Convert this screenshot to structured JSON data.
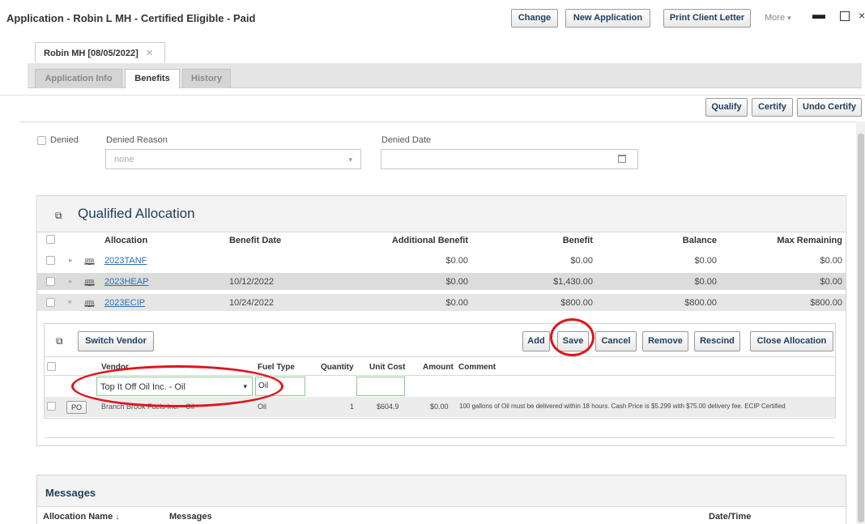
{
  "window": {
    "title": "Application - Robin L MH - Certified Eligible - Paid",
    "buttons": {
      "change": "Change",
      "new_application": "New Application",
      "print_letter": "Print Client Letter",
      "more": "More"
    }
  },
  "doc_tab": {
    "label": "Robin MH [08/05/2022]"
  },
  "tabs": [
    "Application Info",
    "Benefits",
    "History"
  ],
  "toolbar": {
    "qualify": "Qualify",
    "certify": "Certify",
    "undo_certify": "Undo Certify"
  },
  "denied": {
    "checkbox_label": "Denied",
    "reason_label": "Denied Reason",
    "reason_value": "none",
    "date_label": "Denied Date",
    "date_value": ""
  },
  "allocation": {
    "title": "Qualified Allocation",
    "headers": [
      "Allocation",
      "Benefit Date",
      "Additional Benefit",
      "Benefit",
      "Balance",
      "Max Remaining"
    ],
    "rows": [
      {
        "name": "2023TANF",
        "date": "",
        "additional": "$0.00",
        "benefit": "$0.00",
        "balance": "$0.00",
        "max": "$0.00",
        "expanded": false
      },
      {
        "name": "2023HEAP",
        "date": "10/12/2022",
        "additional": "$0.00",
        "benefit": "$1,430.00",
        "balance": "$0.00",
        "max": "$0.00",
        "expanded": false
      },
      {
        "name": "2023ECIP",
        "date": "10/24/2022",
        "additional": "$0.00",
        "benefit": "$800.00",
        "balance": "$800.00",
        "max": "$800.00",
        "expanded": true
      }
    ]
  },
  "vendor_panel": {
    "switch_vendor": "Switch Vendor",
    "actions": {
      "add": "Add",
      "save": "Save",
      "cancel": "Cancel",
      "remove": "Remove",
      "rescind": "Rescind",
      "close_allocation": "Close Allocation"
    },
    "headers": [
      "Vendor",
      "Fuel Type",
      "Quantity",
      "Unit Cost",
      "Amount",
      "Comment"
    ],
    "edit_row": {
      "vendor": "Top It Off Oil Inc. - Oil",
      "fuel_type": "Oil",
      "unit_cost": ""
    },
    "row": {
      "po": "PO",
      "vendor": "Branch Brook Fuels Inc. - Oil",
      "fuel_type": "Oil",
      "quantity": "1",
      "unit_cost": "$604.9",
      "amount": "$0.00",
      "comment": "100 gallons of Oil must be delivered within 18 hours. Cash Price is $5.299 with $75.00 delivery fee. ECIP Certified"
    }
  },
  "messages": {
    "title": "Messages",
    "headers": {
      "allocation_name": "Allocation Name",
      "messages": "Messages",
      "datetime": "Date/Time"
    }
  },
  "icons": [
    "minimize-icon",
    "maximize-icon",
    "close-icon",
    "calendar-icon",
    "allocation-icon",
    "vendor-icon",
    "book-icon",
    "expand-arrow-icon",
    "dropdown-arrow-icon",
    "sort-down-icon"
  ],
  "colors": {
    "link": "#2a6fb0",
    "annotation": "#e0141b",
    "title": "#1f3d5c"
  }
}
